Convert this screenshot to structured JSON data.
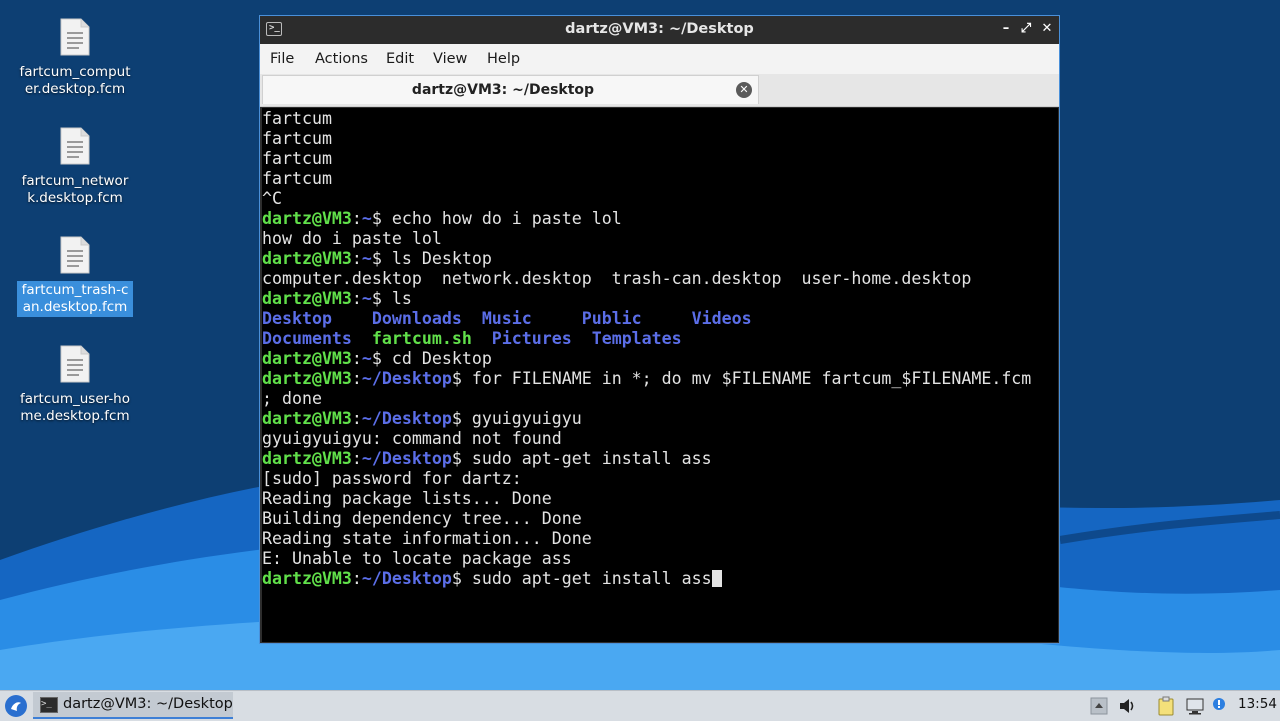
{
  "desktop": {
    "icons": [
      {
        "label": "fartcum_computer.desktop.fcm",
        "selected": false
      },
      {
        "label": "fartcum_network.desktop.fcm",
        "selected": false
      },
      {
        "label": "fartcum_trash-can.desktop.fcm",
        "selected": true
      },
      {
        "label": "fartcum_user-home.desktop.fcm",
        "selected": false
      }
    ]
  },
  "window": {
    "title": "dartz@VM3: ~/Desktop",
    "menu": [
      "File",
      "Actions",
      "Edit",
      "View",
      "Help"
    ],
    "tab_label": "dartz@VM3: ~/Desktop",
    "buttons": {
      "minimize": "–",
      "maximize": "⤢",
      "close": "✕"
    }
  },
  "terminal": {
    "output": [
      "fartcum",
      "fartcum",
      "fartcum",
      "fartcum",
      "^C"
    ],
    "session": [
      {
        "type": "prompt",
        "user": "dartz@VM3",
        "sep": ":",
        "path": "~",
        "sym": "$",
        "cmd": " echo how do i paste lol"
      },
      {
        "type": "text",
        "text": "how do i paste lol"
      },
      {
        "type": "prompt",
        "user": "dartz@VM3",
        "sep": ":",
        "path": "~",
        "sym": "$",
        "cmd": " ls Desktop"
      },
      {
        "type": "text",
        "text": "computer.desktop  network.desktop  trash-can.desktop  user-home.desktop"
      },
      {
        "type": "prompt",
        "user": "dartz@VM3",
        "sep": ":",
        "path": "~",
        "sym": "$",
        "cmd": " ls"
      },
      {
        "type": "ls",
        "items": [
          {
            "name": "Desktop",
            "kind": "dir",
            "pad": "    "
          },
          {
            "name": "Downloads",
            "kind": "dir",
            "pad": "  "
          },
          {
            "name": "Music",
            "kind": "dir",
            "pad": "     "
          },
          {
            "name": "Public",
            "kind": "dir",
            "pad": "     "
          },
          {
            "name": "Videos",
            "kind": "dir",
            "pad": ""
          }
        ]
      },
      {
        "type": "ls",
        "items": [
          {
            "name": "Documents",
            "kind": "dir",
            "pad": "  "
          },
          {
            "name": "fartcum.sh",
            "kind": "exe",
            "pad": "  "
          },
          {
            "name": "Pictures",
            "kind": "dir",
            "pad": "  "
          },
          {
            "name": "Templates",
            "kind": "dir",
            "pad": ""
          }
        ]
      },
      {
        "type": "prompt",
        "user": "dartz@VM3",
        "sep": ":",
        "path": "~",
        "sym": "$",
        "cmd": " cd Desktop"
      },
      {
        "type": "prompt",
        "user": "dartz@VM3",
        "sep": ":",
        "path": "~/Desktop",
        "sym": "$",
        "cmd": " for FILENAME in *; do mv $FILENAME fartcum_$FILENAME.fcm"
      },
      {
        "type": "text",
        "text": "; done"
      },
      {
        "type": "prompt",
        "user": "dartz@VM3",
        "sep": ":",
        "path": "~/Desktop",
        "sym": "$",
        "cmd": " gyuigyuigyu"
      },
      {
        "type": "text",
        "text": "gyuigyuigyu: command not found"
      },
      {
        "type": "prompt",
        "user": "dartz@VM3",
        "sep": ":",
        "path": "~/Desktop",
        "sym": "$",
        "cmd": " sudo apt-get install ass"
      },
      {
        "type": "text",
        "text": "[sudo] password for dartz:"
      },
      {
        "type": "text",
        "text": "Reading package lists... Done"
      },
      {
        "type": "text",
        "text": "Building dependency tree... Done"
      },
      {
        "type": "text",
        "text": "Reading state information... Done"
      },
      {
        "type": "text",
        "text": "E: Unable to locate package ass"
      },
      {
        "type": "prompt",
        "user": "dartz@VM3",
        "sep": ":",
        "path": "~/Desktop",
        "sym": "$",
        "cmd": " sudo apt-get install ass",
        "cursor": true
      }
    ]
  },
  "taskbar": {
    "task_label": "dartz@VM3: ~/Desktop",
    "clock": "13:54"
  },
  "colors": {
    "prompt_user": "#61e04a",
    "prompt_path": "#5b6ee8",
    "window_border": "#4a90d9"
  }
}
